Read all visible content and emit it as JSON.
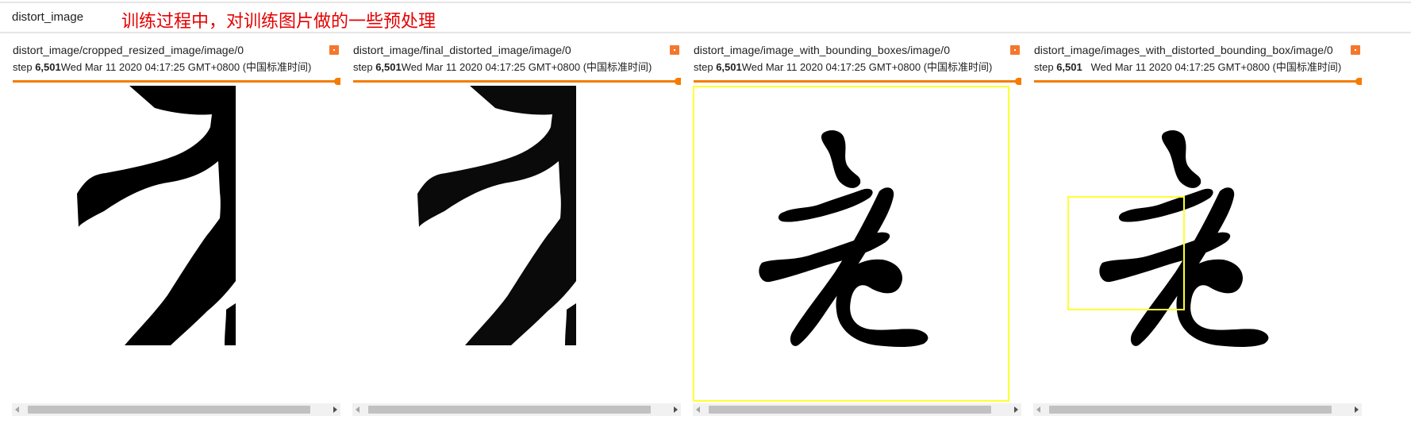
{
  "header": {
    "group_name": "distort_image",
    "annotation": "训练过程中，对训练图片做的一些预处理",
    "annotation_color": "#e60000"
  },
  "accent_color": "#f57c00",
  "bounding_box_color": "#ffff33",
  "cards": [
    {
      "title": "distort_image/cropped_resized_image/image/0",
      "step_label": "step",
      "step_value": "6,501",
      "timestamp": "Wed Mar 11 2020 04:17:25 GMT+0800 (中国标准时间)",
      "pin_icon": "pin-icon",
      "slider_value": 1.0
    },
    {
      "title": "distort_image/final_distorted_image/image/0",
      "step_label": "step",
      "step_value": "6,501",
      "timestamp": "Wed Mar 11 2020 04:17:25 GMT+0800 (中国标准时间)",
      "pin_icon": "pin-icon",
      "slider_value": 1.0
    },
    {
      "title": "distort_image/image_with_bounding_boxes/image/0",
      "step_label": "step",
      "step_value": "6,501",
      "timestamp": "Wed Mar 11 2020 04:17:25 GMT+0800 (中国标准时间)",
      "pin_icon": "pin-icon",
      "slider_value": 1.0
    },
    {
      "title": "distort_image/images_with_distorted_bounding_box/image/0",
      "step_label": "step",
      "step_value": "6,501",
      "timestamp": "Wed Mar 11 2020 04:17:25 GMT+0800 (中国标准时间)",
      "pin_icon": "pin-icon",
      "slider_value": 1.0
    }
  ]
}
